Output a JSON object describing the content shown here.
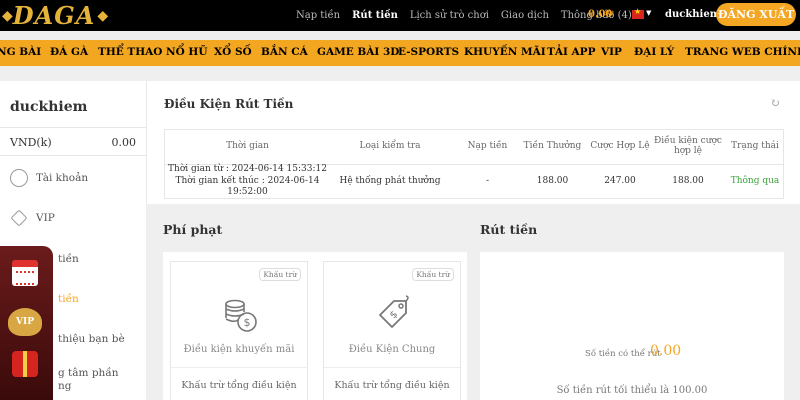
{
  "header": {
    "logo_text": "DAGA",
    "nav": [
      "Nạp tiền",
      "Rút tiền",
      "Lịch sử trò chơi",
      "Giao dịch",
      "Thông báo (4)"
    ],
    "active_nav": "Rút tiền",
    "balance": "0.00",
    "username": "duckhiem",
    "logout_label": "ĐĂNG XUẤT"
  },
  "main_nav": [
    "NG BÀI",
    "ĐÁ GÀ",
    "THỂ THAO",
    "NỔ HŨ",
    "XỔ SỐ",
    "BẮN CÁ",
    "GAME BÀI 3D",
    "E-SPORTS",
    "KHUYẾN MÃI",
    "TẢI APP",
    "VIP",
    "ĐẠI LÝ",
    "TRANG WEB CHÍNH TH"
  ],
  "sidebar": {
    "username": "duckhiem",
    "currency": "VND(k)",
    "amount": "0.00",
    "items": [
      {
        "label": "Tài khoản",
        "icon": "user-icon"
      },
      {
        "label": "VIP",
        "icon": "vip-icon"
      },
      {
        "label": "tiền",
        "icon": "deposit-icon"
      },
      {
        "label": "tiền",
        "icon": "withdraw-icon"
      },
      {
        "label": "thiệu bạn bè",
        "icon": "referral-icon"
      },
      {
        "label": "g tâm phần",
        "icon": "center-icon"
      },
      {
        "label": "ng",
        "icon": "center-icon"
      }
    ]
  },
  "promo": {
    "vip_label": "VIP"
  },
  "conditions": {
    "title": "Điều Kiện Rút Tiền",
    "columns": [
      "Thời gian",
      "Loại kiểm tra",
      "Nạp tiền",
      "Tiền Thưởng",
      "Cược Hợp Lệ",
      "Điều kiện cược hợp lệ",
      "Trạng thái"
    ],
    "row": {
      "time_start": "Thời gian từ : 2024-06-14 15:33:12",
      "time_end": "Thời gian kết thúc : 2024-06-14 19:52:00",
      "type": "Hệ thống phát thưởng",
      "deposit": "-",
      "bonus": "188.00",
      "valid_bet": "247.00",
      "condition": "188.00",
      "status": "Thông qua"
    },
    "colors": {
      "status_ok": "#3aa13a"
    }
  },
  "penalty": {
    "title": "Phí phạt",
    "cards": [
      {
        "badge": "Khấu trừ",
        "name": "Điều kiện khuyến mãi",
        "desc": "Khấu trừ tổng điều kiện",
        "icon": "coins-dollar-icon"
      },
      {
        "badge": "Khấu trừ",
        "name": "Điều Kiện Chung",
        "desc": "Khấu trừ tổng điều kiện",
        "icon": "tag-dollar-icon"
      }
    ]
  },
  "withdraw": {
    "title": "Rút tiền",
    "available_label": "Số tiền có thể rút",
    "available_amount": "0.00",
    "min_text": "Số tiền rút tối thiểu là 100.00"
  },
  "colors": {
    "accent": "#f5a623",
    "nav_bg": "#f3a61f",
    "header_bg": "#000000"
  }
}
